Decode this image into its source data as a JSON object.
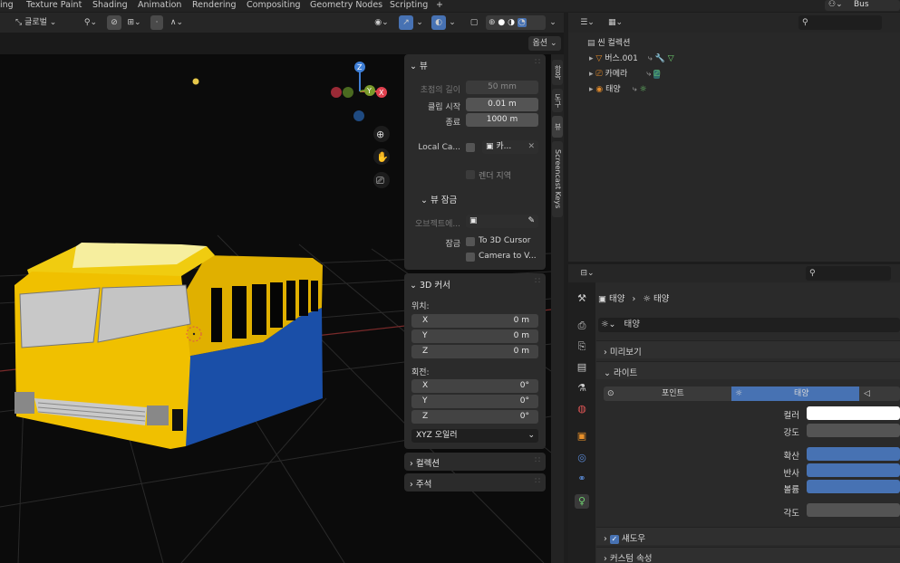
{
  "topbar": {
    "tabs": [
      "ing",
      "Texture Paint",
      "Shading",
      "Animation",
      "Rendering",
      "Compositing",
      "Geometry Nodes",
      "Scripting",
      "+"
    ],
    "scene_name": "Bus"
  },
  "viewport_header": {
    "transform_orientation": "글로벌",
    "options_label": "옵션"
  },
  "npanel": {
    "view_section": {
      "title": "뷰",
      "focal_label": "초점의 길이",
      "focal_value": "50 mm",
      "clip_start_label": "클립 시작",
      "clip_start_value": "0.01 m",
      "clip_end_label": "종료",
      "clip_end_value": "1000 m",
      "local_camera_label": "Local Ca...",
      "local_camera_value": "카...",
      "render_region_label": "렌더 지역"
    },
    "view_lock": {
      "title": "뷰 잠금",
      "object_label": "오브젝트에...",
      "lock_label": "잠금",
      "to_cursor": "To 3D Cursor",
      "camera_to_view": "Camera to V..."
    },
    "cursor_section": {
      "title": "3D 커서",
      "location_label": "위치:",
      "loc_x_label": "X",
      "loc_x": "0 m",
      "loc_y_label": "Y",
      "loc_y": "0 m",
      "loc_z_label": "Z",
      "loc_z": "0 m",
      "rotation_label": "회전:",
      "rot_x_label": "X",
      "rot_x": "0°",
      "rot_y_label": "Y",
      "rot_y": "0°",
      "rot_z_label": "Z",
      "rot_z": "0°",
      "rotation_mode": "XYZ 오일러"
    },
    "collection_title": "컬렉션",
    "annotation_title": "주석"
  },
  "side_tabs": [
    "항목",
    "도구",
    "뷰",
    "Screencast Keys"
  ],
  "outliner": {
    "root": "씬 컬렉션",
    "items": [
      {
        "label": "버스.001"
      },
      {
        "label": "카메라"
      },
      {
        "label": "태양"
      }
    ]
  },
  "properties": {
    "breadcrumb_obj": "태양",
    "breadcrumb_data": "태양",
    "datablock_name": "태양",
    "preview_section": "미리보기",
    "light_section": "라이트",
    "light_types": [
      "포인트",
      "태양"
    ],
    "active_light_type": "태양",
    "color_label": "컬러",
    "strength_label": "강도",
    "diffuse_label": "확산",
    "specular_label": "반사",
    "volume_label": "볼륨",
    "angle_label": "각도",
    "shadow_section": "섀도우",
    "custom_props_section": "커스텀 속성"
  },
  "colors": {
    "accent_blue": "#4772b3",
    "bus_yellow": "#e6b800",
    "bus_blue": "#1a4fa8"
  }
}
